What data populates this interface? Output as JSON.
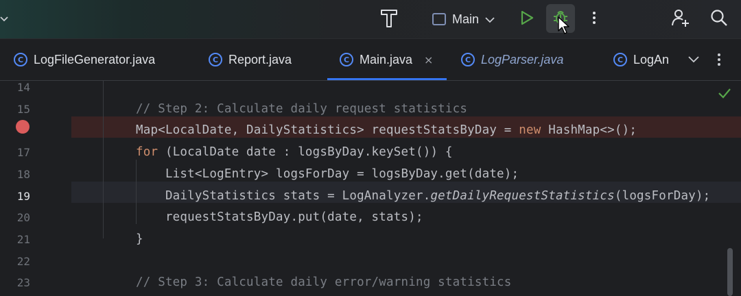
{
  "toolbar": {
    "run_config_label": "Main",
    "icons": {
      "menu": "chevron-down-icon",
      "build": "hammer-icon",
      "config": "application-config-icon",
      "config_dropdown": "chevron-down-icon",
      "run": "play-icon",
      "debug": "bug-icon",
      "more": "more-vertical-icon",
      "user": "add-user-icon",
      "search": "search-icon"
    },
    "colors": {
      "run": "#57a64a",
      "debug": "#57a64a"
    }
  },
  "tabs": [
    {
      "label": "LogFileGenerator.java",
      "icon": "class-icon",
      "active": false,
      "italic": false
    },
    {
      "label": "Report.java",
      "icon": "class-icon",
      "active": false,
      "italic": false
    },
    {
      "label": "Main.java",
      "icon": "class-icon",
      "active": true,
      "italic": false,
      "close": "×"
    },
    {
      "label": "LogParser.java",
      "icon": "class-icon",
      "active": false,
      "italic": true
    },
    {
      "label": "LogAn",
      "icon": "class-icon",
      "active": false,
      "italic": false
    }
  ],
  "tab_icon_letter": "C",
  "editor": {
    "current_line": 19,
    "breakpoint_line": 16,
    "status_icon": "check-icon",
    "lines": [
      {
        "num": "14",
        "segments": []
      },
      {
        "num": "15",
        "segments": [
          {
            "text": "// Step 2: Calculate daily request statistics",
            "type": "comment"
          }
        ]
      },
      {
        "num": "",
        "segments": [
          {
            "text": "Map<LocalDate, DailyStatistics> requestStatsByDay = ",
            "type": "plain"
          },
          {
            "text": "new",
            "type": "keyword"
          },
          {
            "text": " HashMap<>();",
            "type": "plain"
          }
        ]
      },
      {
        "num": "17",
        "segments": [
          {
            "text": "for",
            "type": "keyword"
          },
          {
            "text": " (LocalDate date : logsByDay.keySet()) {",
            "type": "plain"
          }
        ]
      },
      {
        "num": "18",
        "segments": [
          {
            "text": "    List<LogEntry> logsForDay = logsByDay.get(date);",
            "type": "plain"
          }
        ]
      },
      {
        "num": "19",
        "segments": [
          {
            "text": "    DailyStatistics stats = LogAnalyzer.",
            "type": "plain"
          },
          {
            "text": "getDailyRequestStatistics",
            "type": "italic"
          },
          {
            "text": "(logsForDay);",
            "type": "plain"
          }
        ]
      },
      {
        "num": "20",
        "segments": [
          {
            "text": "    requestStatsByDay.put(date, stats);",
            "type": "plain"
          }
        ]
      },
      {
        "num": "21",
        "segments": [
          {
            "text": "}",
            "type": "plain"
          }
        ]
      },
      {
        "num": "22",
        "segments": []
      },
      {
        "num": "23",
        "segments": [
          {
            "text": "// Step 3: Calculate daily error/warning statistics",
            "type": "comment"
          }
        ]
      }
    ]
  }
}
